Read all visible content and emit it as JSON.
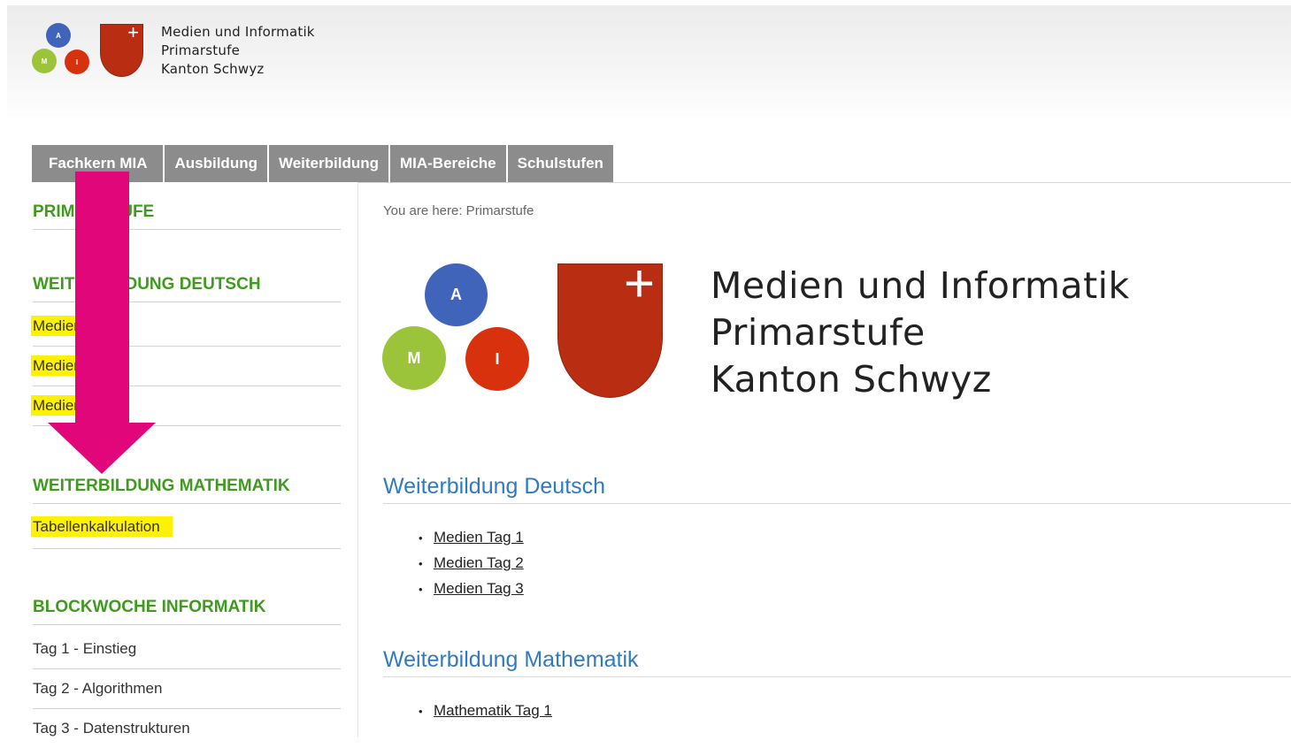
{
  "header": {
    "logo_letters": {
      "a": "A",
      "m": "M",
      "i": "I"
    },
    "logo_lines": [
      "Medien und Informatik",
      "Primarstufe",
      "Kanton Schwyz"
    ]
  },
  "nav": {
    "tabs": [
      "Fachkern MIA",
      "Ausbildung",
      "Weiterbildung",
      "MIA-Bereiche",
      "Schulstufen"
    ]
  },
  "sidebar": {
    "sections": [
      {
        "heading": "PRIMARSTUFE",
        "items": []
      },
      {
        "heading": "WEITERBILDUNG DEUTSCH",
        "items": [
          "Medien Tag 1",
          "Medien Tag 2",
          "Medien Tag 3"
        ]
      },
      {
        "heading": "WEITERBILDUNG MATHEMATIK",
        "items": [
          "Tabellenkalkulation"
        ]
      },
      {
        "heading": "BLOCKWOCHE INFORMATIK",
        "items": [
          "Tag 1 - Einstieg",
          "Tag 2 - Algorithmen",
          "Tag 3 - Datenstrukturen"
        ]
      }
    ]
  },
  "main": {
    "breadcrumb": "You are here: Primarstufe",
    "sections": [
      {
        "title": "Weiterbildung Deutsch",
        "links": [
          "Medien Tag 1",
          "Medien Tag 2",
          "Medien Tag 3"
        ]
      },
      {
        "title": "Weiterbildung Mathematik",
        "links": [
          "Mathematik Tag 1"
        ]
      }
    ]
  },
  "colors": {
    "circle_a": "#4164bb",
    "circle_m": "#9bc43b",
    "circle_i": "#d7320d",
    "shield": "#b92d13",
    "nav_tab": "#8c8c8c",
    "sidebar_heading": "#3f9b1d",
    "section_title": "#2f7bc3",
    "highlight": "#fff200",
    "arrow": "#e1077a"
  }
}
